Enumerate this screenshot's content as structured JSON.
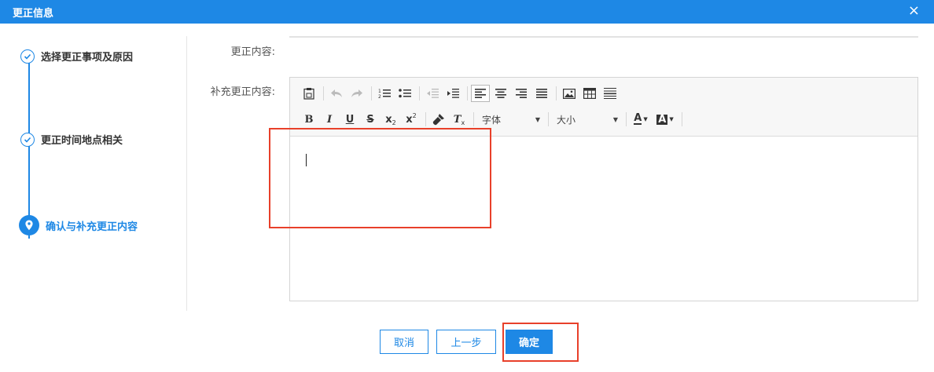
{
  "dialog": {
    "title": "更正信息",
    "close_glyph": "×"
  },
  "steps": [
    {
      "label": "选择更正事项及原因",
      "state": "done"
    },
    {
      "label": "更正时间地点相关",
      "state": "done"
    },
    {
      "label": "确认与补充更正内容",
      "state": "current"
    }
  ],
  "form": {
    "content_label": "更正内容:",
    "supplement_label": "补充更正内容:"
  },
  "editor": {
    "font_family_select": "字体",
    "font_size_select": "大小",
    "toolbar_row1_icons": [
      "paste-word-icon",
      "undo-icon",
      "redo-icon",
      "ordered-list-icon",
      "unordered-list-icon",
      "outdent-icon",
      "indent-icon",
      "align-left-icon",
      "align-center-icon",
      "align-right-icon",
      "justify-icon",
      "image-icon",
      "table-icon",
      "horizontal-rule-icon"
    ],
    "toolbar_row2_icons": [
      "bold-icon",
      "italic-icon",
      "underline-icon",
      "strikethrough-icon",
      "subscript-icon",
      "superscript-icon",
      "format-painter-icon",
      "clear-format-icon",
      "font-color-icon",
      "background-color-icon"
    ],
    "bold_glyph": "B",
    "italic_glyph": "I",
    "underline_glyph": "U",
    "strike_glyph": "S",
    "sub_glyph": "x",
    "sub_mark": "2",
    "sup_glyph": "x",
    "sup_mark": "2",
    "clear_glyph": "T",
    "clear_mark": "x",
    "font_color_glyph": "A",
    "bg_color_glyph": "A"
  },
  "buttons": {
    "cancel": "取消",
    "prev": "上一步",
    "confirm": "确定"
  },
  "colors": {
    "primary": "#1E88E5",
    "highlight": "#e8402a"
  }
}
